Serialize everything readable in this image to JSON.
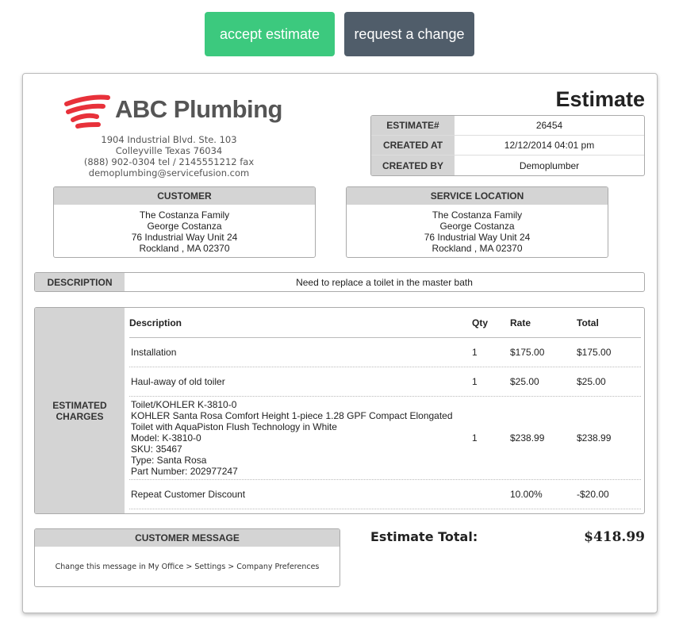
{
  "actions": {
    "accept_label": "accept estimate",
    "change_label": "request a change",
    "accept_color": "#3cc97e",
    "change_color": "#505d6a"
  },
  "company": {
    "name": "ABC Plumbing",
    "logo_icon": "brush-stroke-logo",
    "brand_color": "#e8313a",
    "address_line1": "1904 Industrial Blvd. Ste. 103",
    "address_line2": "Colleyville Texas 76034",
    "phone_line": "(888) 902-0304 tel / 2145551212 fax",
    "email": "demoplumbing@servicefusion.com"
  },
  "document": {
    "title": "Estimate",
    "meta": [
      {
        "label": "ESTIMATE#",
        "value": "26454"
      },
      {
        "label": "CREATED AT",
        "value": "12/12/2014 04:01 pm"
      },
      {
        "label": "CREATED BY",
        "value": "Demoplumber"
      }
    ]
  },
  "customer": {
    "heading": "CUSTOMER",
    "lines": [
      "The Costanza Family",
      "George Costanza",
      "76 Industrial Way Unit 24",
      "Rockland , MA 02370"
    ]
  },
  "service_location": {
    "heading": "SERVICE LOCATION",
    "lines": [
      "The Costanza Family",
      "George Costanza",
      "76 Industrial Way Unit 24",
      "Rockland , MA 02370"
    ]
  },
  "description": {
    "label": "DESCRIPTION",
    "value": "Need to replace a toilet in the master bath"
  },
  "charges": {
    "label_line1": "ESTIMATED",
    "label_line2": "CHARGES",
    "columns": {
      "description": "Description",
      "qty": "Qty",
      "rate": "Rate",
      "total": "Total"
    },
    "rows": [
      {
        "lines": [
          "Installation"
        ],
        "qty": "1",
        "rate": "$175.00",
        "total": "$175.00"
      },
      {
        "lines": [
          "Haul-away of old toiler"
        ],
        "qty": "1",
        "rate": "$25.00",
        "total": "$25.00"
      },
      {
        "lines": [
          "Toilet/KOHLER K-3810-0",
          "KOHLER Santa Rosa Comfort Height 1-piece 1.28 GPF Compact Elongated",
          "Toilet with AquaPiston Flush Technology in White",
          "Model: K-3810-0",
          "SKU: 35467",
          "Type: Santa Rosa",
          "Part Number: 202977247"
        ],
        "qty": "1",
        "rate": "$238.99",
        "total": "$238.99"
      },
      {
        "lines": [
          "Repeat Customer Discount"
        ],
        "qty": "",
        "rate": "10.00%",
        "total": "-$20.00"
      }
    ]
  },
  "customer_message": {
    "heading": "CUSTOMER MESSAGE",
    "text": "Change this message in My Office > Settings > Company Preferences"
  },
  "totals": {
    "label": "Estimate Total:",
    "value": "$418.99"
  }
}
